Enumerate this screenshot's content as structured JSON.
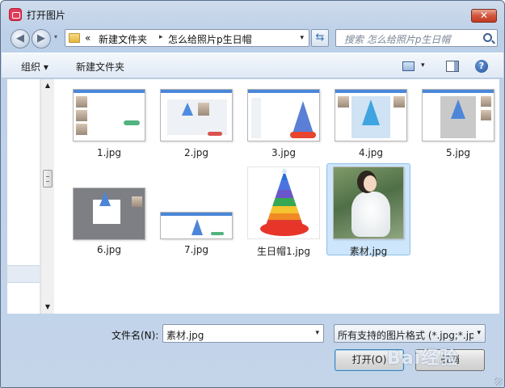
{
  "window": {
    "title": "打开图片",
    "close_symbol": "✕"
  },
  "nav": {
    "back_symbol": "◀",
    "forward_symbol": "▶",
    "history_symbol": "▾"
  },
  "address": {
    "overflow": "«",
    "crumbs": [
      "新建文件夹",
      "怎么给照片p生日帽"
    ],
    "separator": "▸",
    "dropdown": "▾",
    "refresh_symbol": "⇆"
  },
  "search": {
    "placeholder": "搜索 怎么给照片p生日帽"
  },
  "toolbar": {
    "organize_label": "组织 ▾",
    "new_folder_label": "新建文件夹",
    "view_dropdown": "▾",
    "help_symbol": "?"
  },
  "scrollbar": {
    "up": "▲",
    "down": "▼"
  },
  "files": [
    {
      "name": "1.jpg",
      "selected": false
    },
    {
      "name": "2.jpg",
      "selected": false
    },
    {
      "name": "3.jpg",
      "selected": false
    },
    {
      "name": "4.jpg",
      "selected": false
    },
    {
      "name": "5.jpg",
      "selected": false
    },
    {
      "name": "6.jpg",
      "selected": false
    },
    {
      "name": "7.jpg",
      "selected": false
    },
    {
      "name": "生日帽1.jpg",
      "selected": false
    },
    {
      "name": "素材.jpg",
      "selected": true
    }
  ],
  "footer": {
    "filename_label": "文件名(N):",
    "filename_value": "素材.jpg",
    "filename_dropdown": "▾",
    "filter_value": "所有支持的图片格式 (*.jpg;*.jp",
    "filter_dropdown": "▾",
    "open_button": "打开(O)",
    "cancel_button": "取消",
    "watermark": "Bai经验"
  },
  "colors": {
    "selection": "#cde6fb",
    "accent": "#4a87d9",
    "close": "#c43b21"
  }
}
